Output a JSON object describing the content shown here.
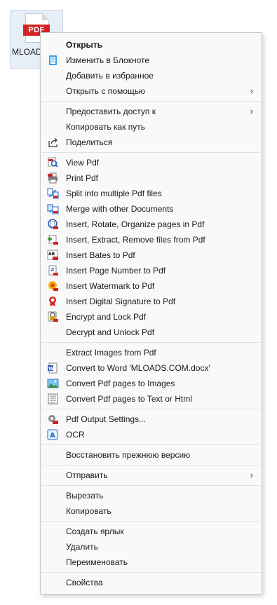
{
  "desktop_file": {
    "badge": "PDF",
    "caption": "MLOADS.CO M.pdf",
    "caption_visible": "MLOADS  M.p"
  },
  "menu": {
    "groups": [
      {
        "items": [
          {
            "label": "Открыть",
            "bold": true,
            "icon": ""
          },
          {
            "label": "Изменить в Блокноте",
            "icon": "notepad-icon"
          },
          {
            "label": "Добавить в избранное",
            "icon": ""
          },
          {
            "label": "Открыть с помощью",
            "icon": "",
            "submenu": true
          }
        ]
      },
      {
        "items": [
          {
            "label": "Предоставить доступ к",
            "icon": "",
            "submenu": true
          },
          {
            "label": "Копировать как путь",
            "icon": ""
          },
          {
            "label": "Поделиться",
            "icon": "share-icon"
          }
        ]
      },
      {
        "items": [
          {
            "label": "View Pdf",
            "icon": "view-pdf-icon"
          },
          {
            "label": "Print Pdf",
            "icon": "print-pdf-icon"
          },
          {
            "label": "Split into multiple Pdf files",
            "icon": "split-pdf-icon"
          },
          {
            "label": "Merge with other Documents",
            "icon": "merge-pdf-icon"
          },
          {
            "label": "Insert, Rotate, Organize pages in Pdf",
            "icon": "organize-pages-icon"
          },
          {
            "label": "Insert, Extract, Remove files from Pdf",
            "icon": "extract-files-icon"
          },
          {
            "label": "Insert Bates to Pdf",
            "icon": "bates-icon"
          },
          {
            "label": "Insert Page Number to Pdf",
            "icon": "page-number-icon"
          },
          {
            "label": "Insert Watermark to Pdf",
            "icon": "watermark-icon"
          },
          {
            "label": "Insert Digital Signature to Pdf",
            "icon": "signature-icon"
          },
          {
            "label": "Encrypt and Lock Pdf",
            "icon": "lock-icon"
          },
          {
            "label": "Decrypt and Unlock Pdf",
            "icon": ""
          }
        ]
      },
      {
        "items": [
          {
            "label": "Extract Images from Pdf",
            "icon": ""
          },
          {
            "label": "Convert to Word 'MLOADS.COM.docx'",
            "icon": "word-icon"
          },
          {
            "label": "Convert Pdf pages to Images",
            "icon": "image-icon"
          },
          {
            "label": "Convert Pdf pages to Text or Html",
            "icon": "text-doc-icon"
          }
        ]
      },
      {
        "items": [
          {
            "label": "Pdf Output Settings...",
            "icon": "settings-pdf-icon"
          },
          {
            "label": "OCR",
            "icon": "ocr-icon"
          }
        ]
      },
      {
        "items": [
          {
            "label": "Восстановить прежнюю версию",
            "icon": ""
          }
        ]
      },
      {
        "items": [
          {
            "label": "Отправить",
            "icon": "",
            "submenu": true
          }
        ]
      },
      {
        "items": [
          {
            "label": "Вырезать",
            "icon": ""
          },
          {
            "label": "Копировать",
            "icon": ""
          }
        ]
      },
      {
        "items": [
          {
            "label": "Создать ярлык",
            "icon": ""
          },
          {
            "label": "Удалить",
            "icon": ""
          },
          {
            "label": "Переименовать",
            "icon": ""
          }
        ]
      },
      {
        "items": [
          {
            "label": "Свойства",
            "icon": ""
          }
        ]
      }
    ],
    "submenu_arrow": "›"
  }
}
